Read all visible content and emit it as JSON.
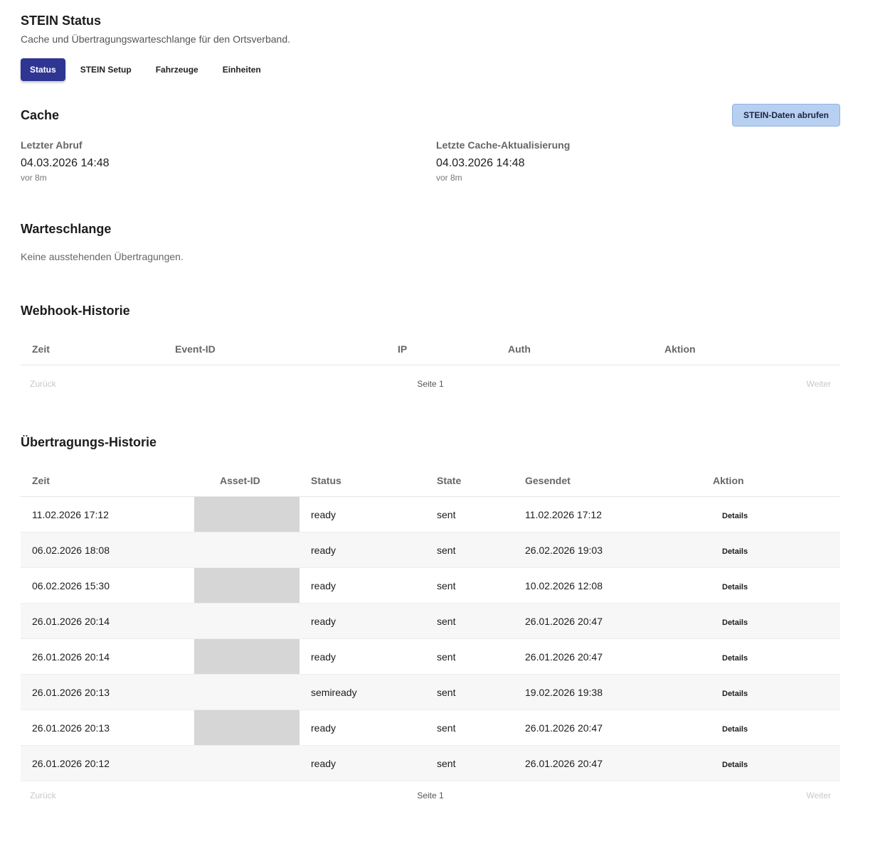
{
  "header": {
    "title": "STEIN Status",
    "subtitle": "Cache und Übertragungswarteschlange für den Ortsverband."
  },
  "tabs": [
    {
      "label": "Status",
      "active": true
    },
    {
      "label": "STEIN Setup",
      "active": false
    },
    {
      "label": "Fahrzeuge",
      "active": false
    },
    {
      "label": "Einheiten",
      "active": false
    }
  ],
  "cache": {
    "title": "Cache",
    "fetch_button": "STEIN-Daten abrufen",
    "last_fetch": {
      "label": "Letzter Abruf",
      "value": "04.03.2026 14:48",
      "relative": "vor 8m"
    },
    "last_update": {
      "label": "Letzte Cache-Aktualisierung",
      "value": "04.03.2026 14:48",
      "relative": "vor 8m"
    }
  },
  "queue": {
    "title": "Warteschlange",
    "empty": "Keine ausstehenden Übertragungen."
  },
  "webhook": {
    "title": "Webhook-Historie",
    "columns": [
      "Zeit",
      "Event-ID",
      "IP",
      "Auth",
      "Aktion"
    ],
    "pager": {
      "prev": "Zurück",
      "page": "Seite 1",
      "next": "Weiter"
    }
  },
  "transfer": {
    "title": "Übertragungs-Historie",
    "columns": [
      "Zeit",
      "Asset-ID",
      "Status",
      "State",
      "Gesendet",
      "Aktion"
    ],
    "rows": [
      {
        "zeit": "11.02.2026 17:12",
        "status": "ready",
        "state": "sent",
        "gesendet": "11.02.2026 17:12",
        "aktion": "Details"
      },
      {
        "zeit": "06.02.2026 18:08",
        "status": "ready",
        "state": "sent",
        "gesendet": "26.02.2026 19:03",
        "aktion": "Details"
      },
      {
        "zeit": "06.02.2026 15:30",
        "status": "ready",
        "state": "sent",
        "gesendet": "10.02.2026 12:08",
        "aktion": "Details"
      },
      {
        "zeit": "26.01.2026 20:14",
        "status": "ready",
        "state": "sent",
        "gesendet": "26.01.2026 20:47",
        "aktion": "Details"
      },
      {
        "zeit": "26.01.2026 20:14",
        "status": "ready",
        "state": "sent",
        "gesendet": "26.01.2026 20:47",
        "aktion": "Details"
      },
      {
        "zeit": "26.01.2026 20:13",
        "status": "semiready",
        "state": "sent",
        "gesendet": "19.02.2026 19:38",
        "aktion": "Details"
      },
      {
        "zeit": "26.01.2026 20:13",
        "status": "ready",
        "state": "sent",
        "gesendet": "26.01.2026 20:47",
        "aktion": "Details"
      },
      {
        "zeit": "26.01.2026 20:12",
        "status": "ready",
        "state": "sent",
        "gesendet": "26.01.2026 20:47",
        "aktion": "Details"
      }
    ],
    "pager": {
      "prev": "Zurück",
      "page": "Seite 1",
      "next": "Weiter"
    }
  }
}
